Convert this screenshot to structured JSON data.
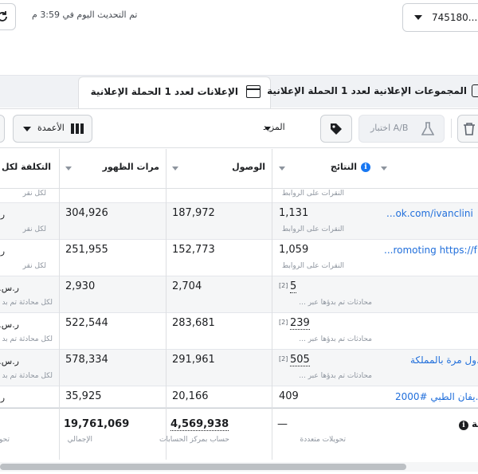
{
  "header": {
    "update_text": "تم التحديث اليوم في 3:59 م",
    "account_value": "745180..."
  },
  "tabs": {
    "ads_label": "الإعلانات لعدد 1 الحملة الإعلانية",
    "adsets_label": "المجموعات الإعلانية لعدد 1 الحملة الإعلانية"
  },
  "toolbar": {
    "columns_label": "الأعمدة",
    "more_label": "المزيد",
    "ab_label": "اختبار A/B"
  },
  "columns": {
    "results": "النتائج",
    "reach": "الوصول",
    "impressions": "مرات الظهور",
    "cost": "التكلفة لكل نت"
  },
  "rows": [
    {
      "name": "",
      "results": "",
      "results_sub": "النقرات على الروابط",
      "reach": "",
      "impressions": "",
      "cost": "",
      "cost_sub": "لكل نقر"
    },
    {
      "name": "...ok.com/ivanclini",
      "results": "1,131",
      "results_sub": "النقرات على الروابط",
      "reach": "187,972",
      "impressions": "304,926",
      "cost": "ر",
      "cost_sub": "لكل نقر"
    },
    {
      "name": "...romoting https://f",
      "results": "1,059",
      "results_sub": "النقرات على الروابط",
      "reach": "152,773",
      "impressions": "251,955",
      "cost": "ر",
      "cost_sub": "لكل نقر"
    },
    {
      "name": "",
      "results": "5",
      "results_note": "[2]",
      "results_sub": "محادثات تم بدؤها عبر ...",
      "reach": "2,704",
      "impressions": "2,930",
      "cost": "ر.س.",
      "cost_sub": "لكل محادثة تم بد"
    },
    {
      "name": "",
      "results": "239",
      "results_note": "[2]",
      "results_sub": "محادثات تم بدؤها عبر ...",
      "reach": "283,681",
      "impressions": "522,544",
      "cost": "ر.س.",
      "cost_sub": "لكل محادثة تم بد"
    },
    {
      "name": "...ول مرة بالمملكة",
      "results": "505",
      "results_note": "[2]",
      "results_sub": "محادثات تم بدؤها عبر ...",
      "reach": "291,961",
      "impressions": "578,334",
      "cost": "ر.س.",
      "cost_sub": "لكل محادثة تم بد"
    },
    {
      "name": "...يفان الطبي #2000",
      "results": "409",
      "results_sub": "",
      "reach": "20,166",
      "impressions": "35,925",
      "cost": "ر",
      "cost_sub": ""
    }
  ],
  "totals": {
    "label": "ية",
    "results": "—",
    "results_sub": "تحويلات متعددة",
    "reach": "4,569,938",
    "reach_sub": "حساب بمركز الحسابات",
    "impressions": "19,761,069",
    "impressions_sub": "الإجمالي",
    "cost_sub": "تحو"
  },
  "colors": {
    "accent": "#1877f2",
    "link": "#216fdb",
    "border": "#dddfe2"
  }
}
